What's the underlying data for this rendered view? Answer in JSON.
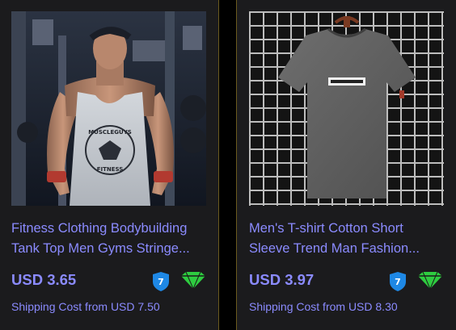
{
  "products": [
    {
      "image_alt": "Fitness tank top",
      "title_line1": "Fitness Clothing Bodybuilding",
      "title_line2": "Tank Top Men Gyms Stringe...",
      "price": "USD 3.65",
      "shipping": "Shipping Cost from USD 7.50",
      "shirt_print_line1": "MUSCLEGUYS",
      "shirt_print_line2": "FITNESS",
      "badge_number": "7"
    },
    {
      "image_alt": "Gray t-shirt",
      "title_line1": "Men's T-shirt Cotton Short",
      "title_line2": "Sleeve Trend Man Fashion...",
      "price": "USD 3.97",
      "shipping": "Shipping Cost from USD 8.30",
      "badge_number": "7"
    }
  ],
  "colors": {
    "text_accent": "#8b8bff",
    "card_bg": "#1b1b1d",
    "badge_blue": "#1e88e5",
    "badge_green": "#2ecc40"
  },
  "icons": [
    "shield-7-icon",
    "diamond-icon"
  ]
}
